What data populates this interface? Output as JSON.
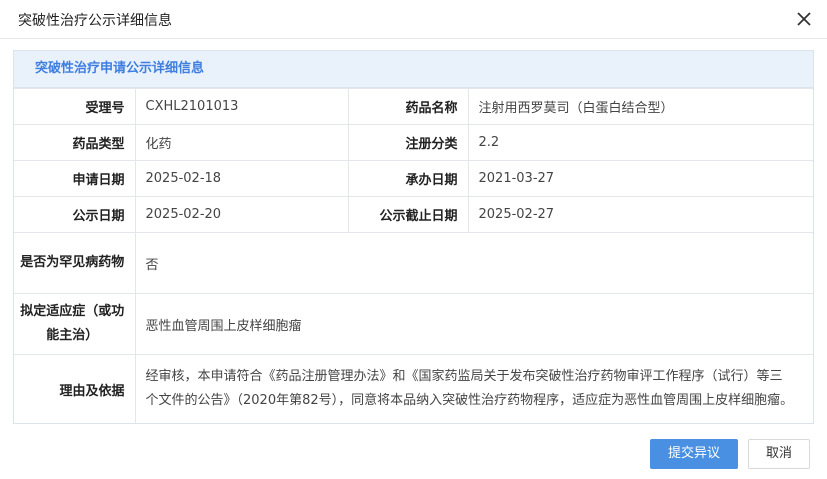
{
  "dialog": {
    "title": "突破性治疗公示详细信息"
  },
  "panel": {
    "header": "突破性治疗申请公示详细信息"
  },
  "fields": {
    "acceptance_no": {
      "label": "受理号",
      "value": "CXHL2101013"
    },
    "drug_name": {
      "label": "药品名称",
      "value": "注射用西罗莫司（白蛋白结合型）"
    },
    "drug_type": {
      "label": "药品类型",
      "value": "化药"
    },
    "reg_class": {
      "label": "注册分类",
      "value": "2.2"
    },
    "apply_date": {
      "label": "申请日期",
      "value": "2025-02-18"
    },
    "handle_date": {
      "label": "承办日期",
      "value": "2021-03-27"
    },
    "publish_date": {
      "label": "公示日期",
      "value": "2025-02-20"
    },
    "publish_end_date": {
      "label": "公示截止日期",
      "value": "2025-02-27"
    },
    "rare_disease": {
      "label": "是否为罕见病药物",
      "value": "否"
    },
    "indication": {
      "label": "拟定适应症（或功能主治）",
      "value": "恶性血管周围上皮样细胞瘤"
    },
    "reason": {
      "label": "理由及依据",
      "value": "经审核，本申请符合《药品注册管理办法》和《国家药监局关于发布突破性治疗药物审评工作程序（试行）等三个文件的公告》（2020年第82号），同意将本品纳入突破性治疗药物程序，适应症为恶性血管周围上皮样细胞瘤。"
    }
  },
  "buttons": {
    "submit": "提交异议",
    "cancel": "取消"
  },
  "colors": {
    "primary": "#4a90e2",
    "header_bg": "#e9f1fb",
    "header_text": "#3e7ee0"
  }
}
